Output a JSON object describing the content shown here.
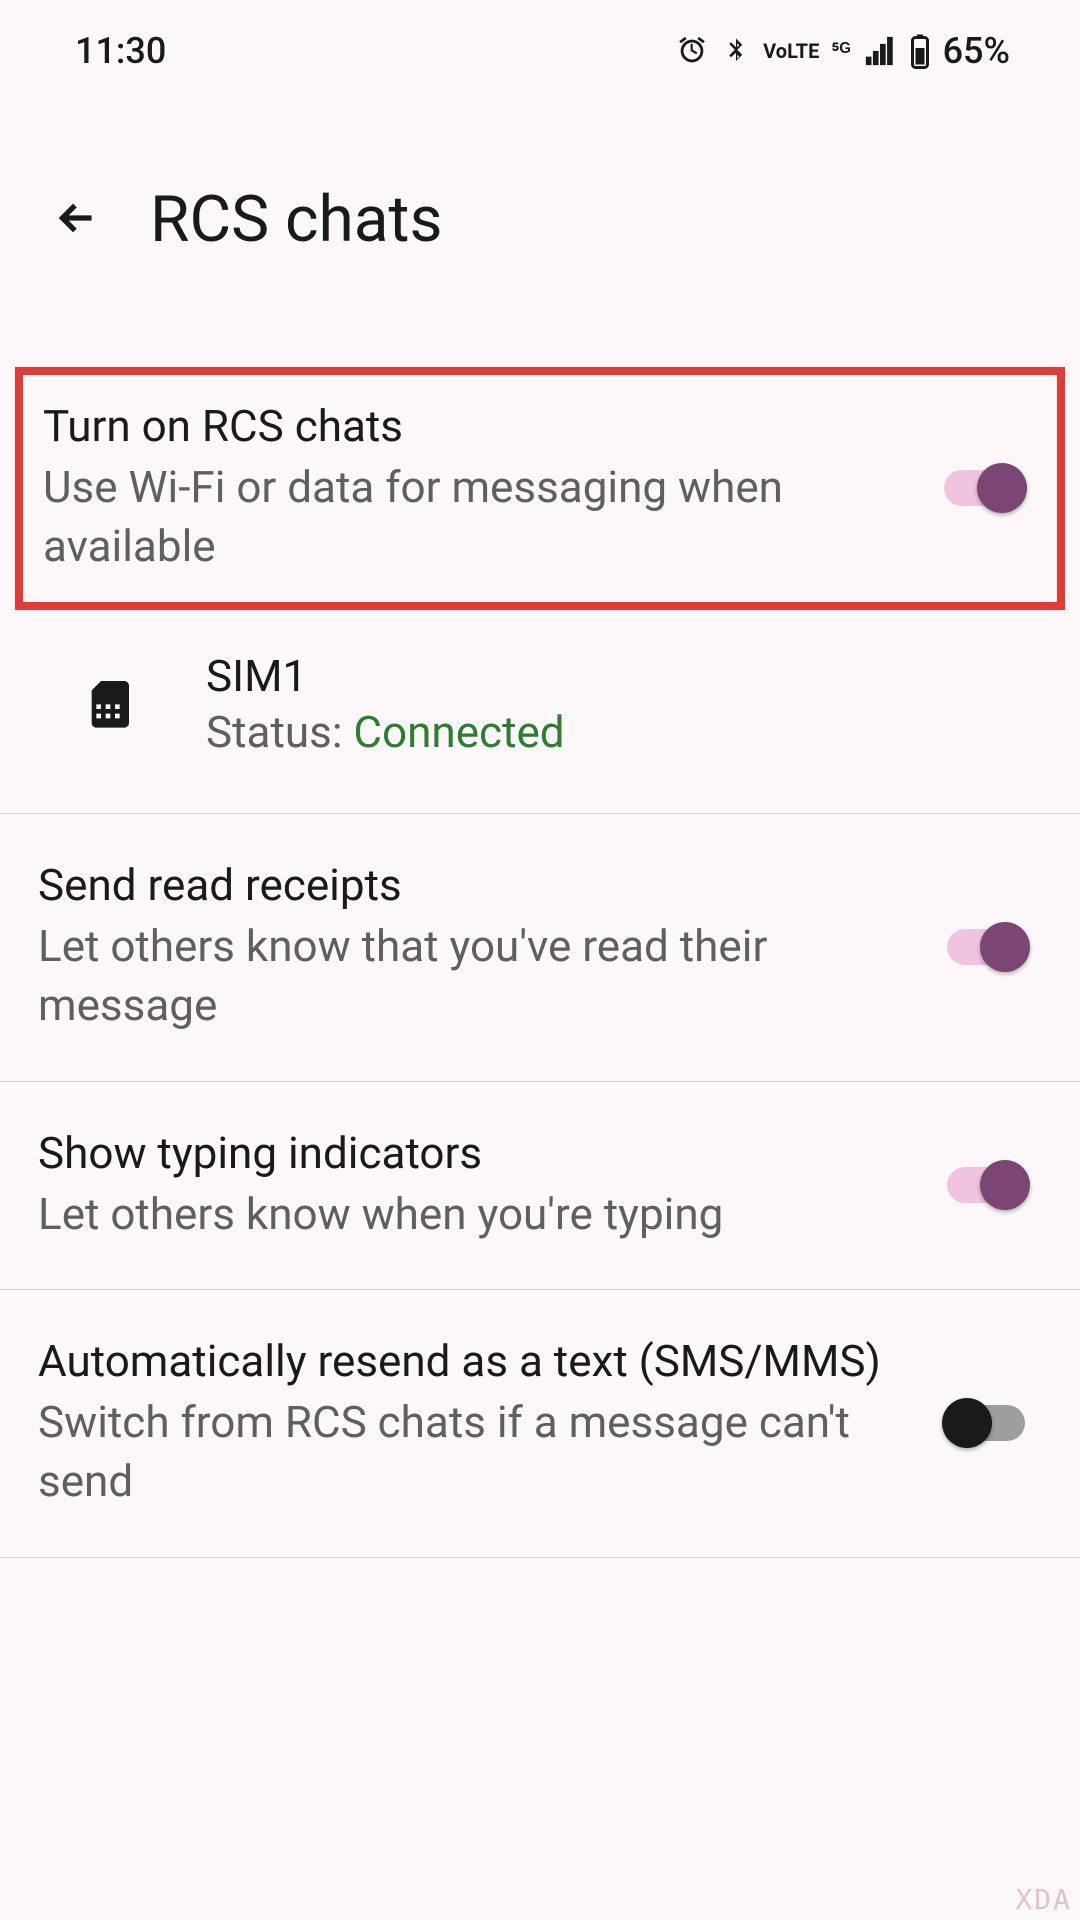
{
  "statusBar": {
    "time": "11:30",
    "battery": "65%"
  },
  "header": {
    "title": "RCS chats"
  },
  "settings": {
    "rcsToggle": {
      "title": "Turn on RCS chats",
      "subtitle": "Use Wi-Fi or data for messaging when available",
      "enabled": true
    },
    "sim": {
      "name": "SIM1",
      "statusLabel": "Status: ",
      "statusValue": "Connected"
    },
    "readReceipts": {
      "title": "Send read receipts",
      "subtitle": "Let others know that you've read their message",
      "enabled": true
    },
    "typingIndicators": {
      "title": "Show typing indicators",
      "subtitle": "Let others know when you're typing",
      "enabled": true
    },
    "autoResend": {
      "title": "Automatically resend as a text (SMS/MMS)",
      "subtitle": "Switch from RCS chats if a message can't send",
      "enabled": false
    }
  },
  "watermark": "XDA"
}
